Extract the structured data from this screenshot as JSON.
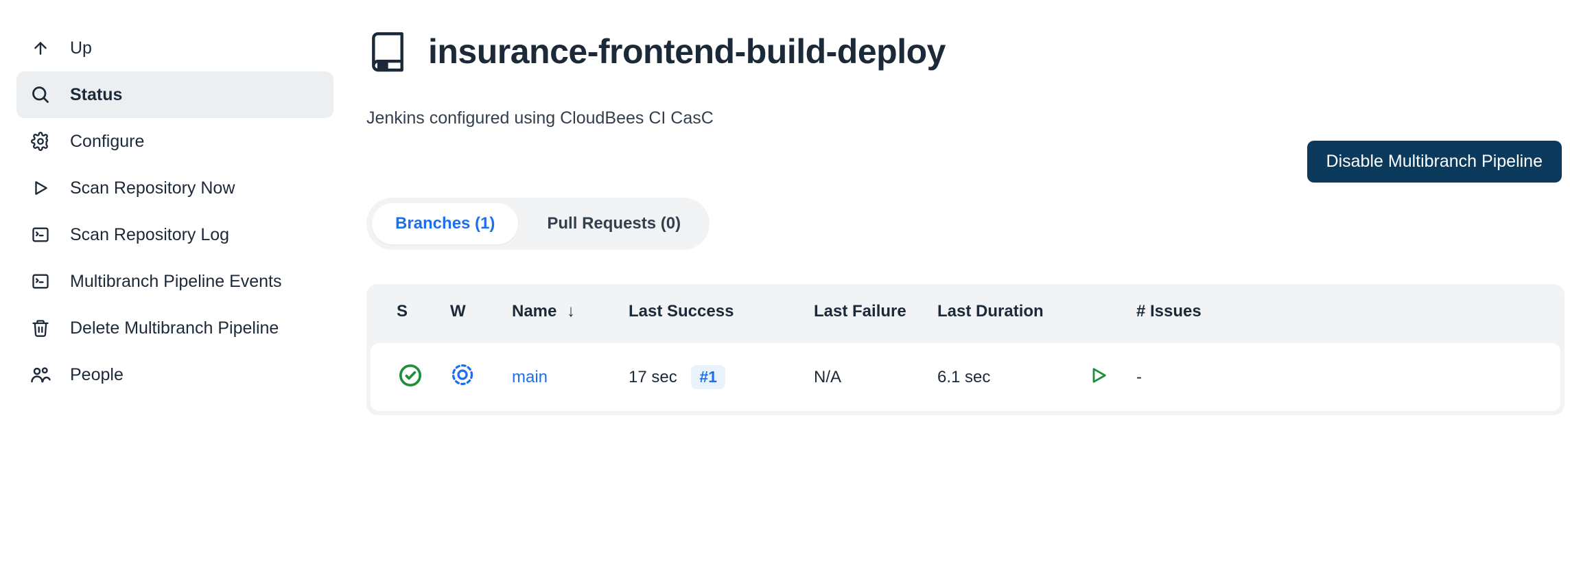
{
  "sidebar": {
    "items": [
      {
        "label": "Up"
      },
      {
        "label": "Status"
      },
      {
        "label": "Configure"
      },
      {
        "label": "Scan Repository Now"
      },
      {
        "label": "Scan Repository Log"
      },
      {
        "label": "Multibranch Pipeline Events"
      },
      {
        "label": "Delete Multibranch Pipeline"
      },
      {
        "label": "People"
      }
    ]
  },
  "header": {
    "title": "insurance-frontend-build-deploy",
    "subtitle": "Jenkins configured using CloudBees CI CasC",
    "disable_button": "Disable Multibranch Pipeline"
  },
  "tabs": {
    "branches": "Branches (1)",
    "pull_requests": "Pull Requests (0)"
  },
  "table": {
    "headers": {
      "s": "S",
      "w": "W",
      "name": "Name",
      "sort_arrow": "↓",
      "last_success": "Last Success",
      "last_failure": "Last Failure",
      "last_duration": "Last Duration",
      "run": "",
      "issues": "# Issues"
    },
    "rows": [
      {
        "status": "success",
        "weather": "sunny",
        "name": "main",
        "last_success": "17 sec",
        "last_success_build": "#1",
        "last_failure": "N/A",
        "last_duration": "6.1 sec",
        "issues": "-"
      }
    ]
  }
}
